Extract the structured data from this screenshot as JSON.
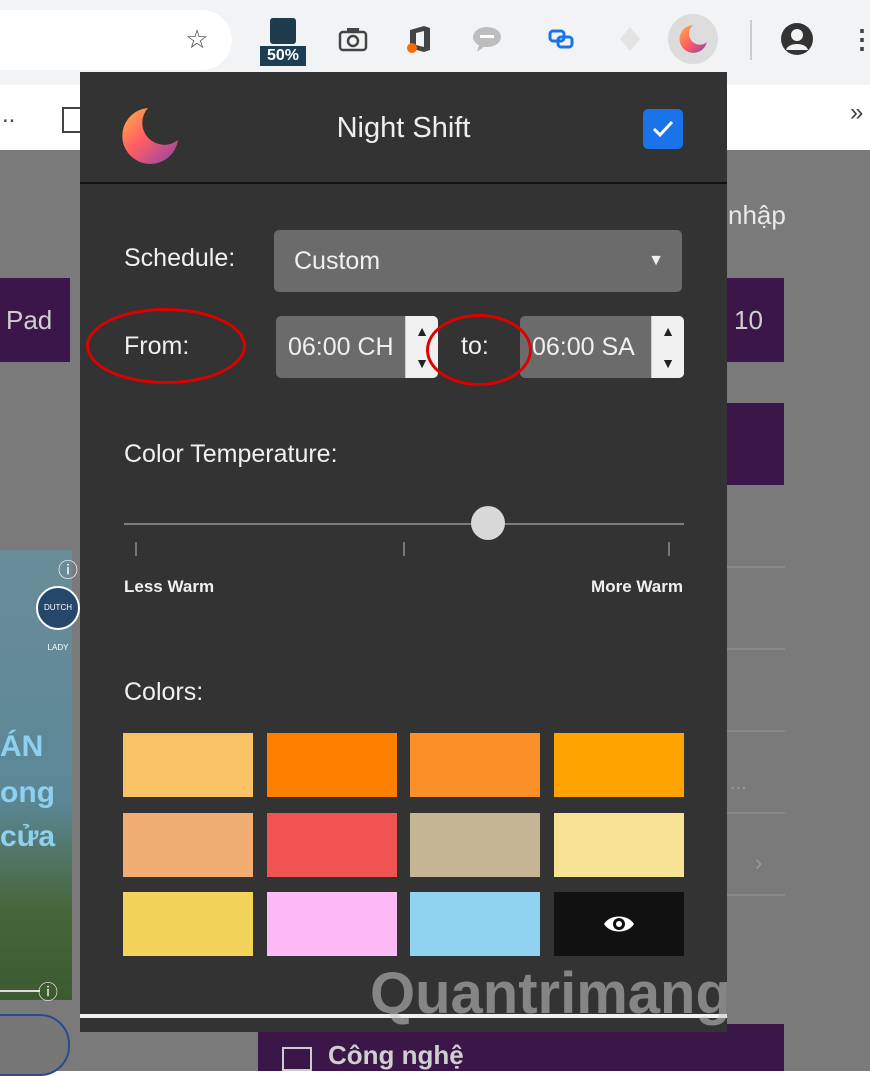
{
  "browser": {
    "extension_badge": "50%",
    "bookmarks_overflow": "»",
    "bookmarks_dots": ".."
  },
  "page_bg": {
    "login_text": "nhập",
    "left_button": "Pad",
    "right_button": "10",
    "bottom_button": "Công nghệ",
    "brand_logo_text": "DUTCH LADY",
    "promo_lines": [
      "ÁN",
      "ong",
      "cửa"
    ],
    "dots": "...",
    "chevron": "›",
    "info_glyph": "ⓘ"
  },
  "popup": {
    "title": "Night Shift",
    "enabled": true,
    "schedule_label": "Schedule:",
    "schedule_value": "Custom",
    "from_label": "From:",
    "from_value": "06:00 CH",
    "to_label": "to:",
    "to_value": "06:00 SA",
    "temp_label": "Color Temperature:",
    "temp_level": 0.65,
    "less_warm": "Less Warm",
    "more_warm": "More Warm",
    "colors_label": "Colors:",
    "colors": [
      "#f8c367",
      "#fd7f00",
      "#fb9028",
      "#fea300",
      "#efad72",
      "#f25454",
      "#c5b594",
      "#f8e394",
      "#f4d35a",
      "#fcb9f5",
      "#8fd3f1",
      "#111111"
    ],
    "last_swatch_icon": "eye-icon"
  },
  "watermark": "Quantrimang",
  "annotation_color": "#e00000"
}
